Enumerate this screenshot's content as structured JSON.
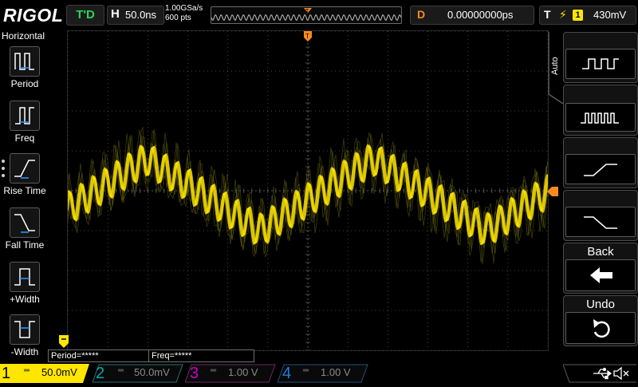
{
  "header": {
    "logo": "RIGOL",
    "run_status": "T'D",
    "horizontal": {
      "tag": "H",
      "timebase": "50.0ns"
    },
    "sample_rate": "1.00GSa/s",
    "memory_depth": "600 pts",
    "delay": {
      "tag": "D",
      "value": "0.00000000ps"
    },
    "trigger": {
      "tag": "T",
      "source": "1",
      "level": "430mV"
    }
  },
  "left_menu": {
    "title": "Horizontal",
    "items": [
      {
        "label": "Period",
        "icon": "period-icon"
      },
      {
        "label": "Freq",
        "icon": "frequency-icon"
      },
      {
        "label": "Rise Time",
        "icon": "rise-time-icon"
      },
      {
        "label": "Fall Time",
        "icon": "fall-time-icon"
      },
      {
        "label": "+Width",
        "icon": "positive-width-icon"
      },
      {
        "label": "-Width",
        "icon": "negative-width-icon"
      }
    ]
  },
  "measurements": {
    "period": "Period=*****",
    "freq": "Freq=*****"
  },
  "right_menu": {
    "mode_label": "Auto",
    "buttons": [
      {
        "name": "pulse-train-icon"
      },
      {
        "name": "burst-train-icon"
      },
      {
        "name": "rising-edge-icon"
      },
      {
        "name": "falling-edge-icon"
      }
    ],
    "back_label": "Back",
    "undo_label": "Undo"
  },
  "channels": [
    {
      "num": "1",
      "scale": "50.0mV",
      "color": "#ffe600",
      "active": true
    },
    {
      "num": "2",
      "scale": "50.0mV",
      "color": "#00a8a8",
      "active": false
    },
    {
      "num": "3",
      "scale": "1.00 V",
      "color": "#d000c8",
      "active": false
    },
    {
      "num": "4",
      "scale": "1.00 V",
      "color": "#1f7fe0",
      "active": false
    }
  ],
  "colors": {
    "trace": "#ffe600",
    "trigger_marker": "#ff8a1c",
    "run_status": "#2fd35b",
    "grid": "#5a5a5a"
  }
}
